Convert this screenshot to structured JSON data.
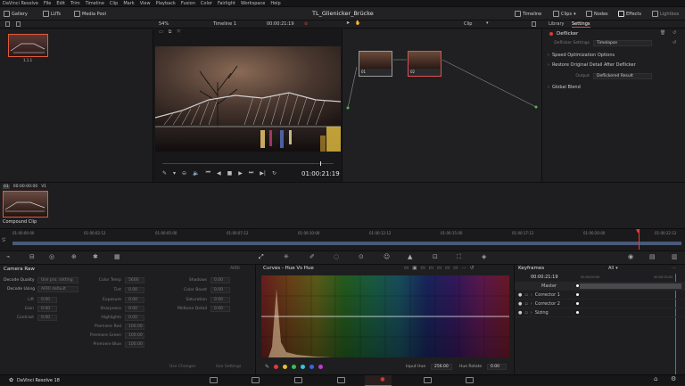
{
  "menubar": {
    "items": [
      "DaVinci Resolve",
      "File",
      "Edit",
      "Trim",
      "Timeline",
      "Clip",
      "Mark",
      "View",
      "Playback",
      "Fusion",
      "Color",
      "Fairlight",
      "Workspace",
      "Help"
    ]
  },
  "pagebar": {
    "gallery": "Gallery",
    "luts": "LUTs",
    "media_pool": "Media Pool",
    "project_title": "TL_Glienicker_Brücke",
    "timeline": "Timeline",
    "clips": "Clips",
    "nodes": "Nodes",
    "effects": "Effects",
    "lightbox": "Lightbox"
  },
  "viewer": {
    "zoom": "54%",
    "timeline_name": "Timeline 1",
    "timecode_top": "00:00:21:19",
    "clip_label": "Clip",
    "timecode": "01:00:21:19"
  },
  "gallery_item": {
    "label": "1.1.1"
  },
  "nodes": [
    {
      "id": "01",
      "label": "01"
    },
    {
      "id": "02",
      "label": "02"
    }
  ],
  "settings_panel": {
    "tab_library": "Library",
    "tab_settings": "Settings",
    "effect_name": "Deflicker",
    "deflicker_settings_label": "Deflicker Settings",
    "deflicker_settings_value": "Timelapse",
    "speed_optimization": "Speed Optimization Options",
    "restore_detail": "Restore Original Detail After Deflicker",
    "output_label": "Output",
    "output_value": "Deflickered Result",
    "global_blend": "Global Blend"
  },
  "clipstrip": {
    "clip_number": "01",
    "clip_timecode": "00:00:00:00",
    "track": "V1",
    "clip_name": "Compound Clip"
  },
  "mini_timeline": {
    "track_label": "V1",
    "ruler": [
      "01:00:00:00",
      "01:00:02:12",
      "01:00:05:00",
      "01:00:07:12",
      "01:00:10:00",
      "01:00:12:12",
      "01:00:15:00",
      "01:00:17:12",
      "01:00:20:00",
      "01:00:22:12"
    ]
  },
  "camera_raw": {
    "title": "Camera Raw",
    "mode": "ARRI",
    "decode_quality_label": "Decode Quality",
    "decode_quality_value": "Use pro. setting",
    "decode_using_label": "Decode Using",
    "decode_using_value": "ARRI default",
    "col1": [
      {
        "label": "Color Temp",
        "value": "5600"
      },
      {
        "label": "Tint",
        "value": "0.00"
      },
      {
        "label": "Exposure",
        "value": "0.00"
      },
      {
        "label": "Sharpness",
        "value": "0.00"
      },
      {
        "label": "Highlights",
        "value": "0.00"
      },
      {
        "label": "Lift",
        "value": "0.00"
      },
      {
        "label": "Gain",
        "value": "0.00"
      },
      {
        "label": "Contrast",
        "value": "0.00"
      }
    ],
    "col0": [
      {
        "label": "Lift",
        "value": "0.00"
      },
      {
        "label": "Gain",
        "value": "0.00"
      },
      {
        "label": "Contrast",
        "value": "0.00"
      }
    ],
    "col2": [
      {
        "label": "Shadows",
        "value": "0.00"
      },
      {
        "label": "Color Boost",
        "value": "0.00"
      },
      {
        "label": "Saturation",
        "value": "0.00"
      },
      {
        "label": "Midtone Detail",
        "value": "0.00"
      }
    ],
    "premiere": [
      {
        "label": "Premiere Red",
        "value": "100.00"
      },
      {
        "label": "Premiere Green",
        "value": "100.00"
      },
      {
        "label": "Premiere Blue",
        "value": "100.00"
      }
    ],
    "use_changes": "Use Changes",
    "use_settings": "Use Settings"
  },
  "curves": {
    "title": "Curves - Hue Vs Hue",
    "input_hue_label": "Input Hue",
    "input_hue_value": "256.00",
    "hue_rotate_label": "Hue Rotate",
    "hue_rotate_value": "0.00",
    "swatches": [
      "#e23a3a",
      "#e0c030",
      "#39c04a",
      "#38c6d0",
      "#3a63e0",
      "#c03ad0"
    ]
  },
  "keyframes": {
    "title": "Keyframes",
    "filter": "All",
    "timecode": "00:00:21:19",
    "ruler_start": "00:00:00:00",
    "ruler_end": "00:00:15:02",
    "rows": [
      {
        "label": "Master"
      },
      {
        "label": "Corrector 1"
      },
      {
        "label": "Corrector 2"
      },
      {
        "label": "Sizing"
      }
    ]
  },
  "bottombar": {
    "app_name": "DaVinci Resolve 18"
  }
}
